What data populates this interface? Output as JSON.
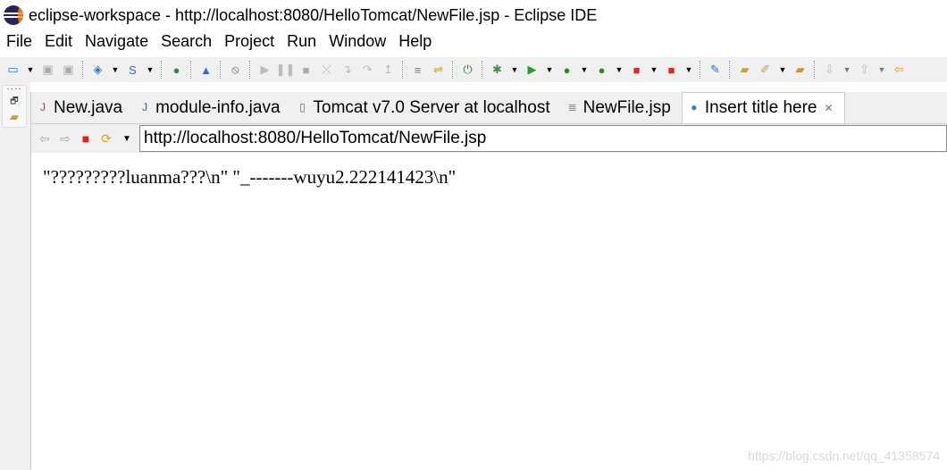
{
  "window": {
    "title": "eclipse-workspace - http://localhost:8080/HelloTomcat/NewFile.jsp - Eclipse IDE"
  },
  "menu": [
    "File",
    "Edit",
    "Navigate",
    "Search",
    "Project",
    "Run",
    "Window",
    "Help"
  ],
  "toolbar": [
    {
      "name": "new-wizard-icon",
      "glyph": "▭",
      "color": "#3a78c8"
    },
    {
      "name": "dropdown-icon",
      "glyph": "▼",
      "color": "#000",
      "dd": true
    },
    {
      "name": "save-icon",
      "glyph": "▣",
      "color": "#aaa"
    },
    {
      "name": "save-all-icon",
      "glyph": "▣",
      "color": "#aaa"
    },
    {
      "sep": true
    },
    {
      "name": "new-web-project-icon",
      "glyph": "◈",
      "color": "#3a78c8"
    },
    {
      "name": "dropdown-icon",
      "glyph": "▼",
      "color": "#000",
      "dd": true
    },
    {
      "name": "new-servlet-icon",
      "glyph": "S",
      "color": "#2a6ac8"
    },
    {
      "name": "dropdown-icon",
      "glyph": "▼",
      "color": "#000",
      "dd": true
    },
    {
      "sep": true
    },
    {
      "name": "open-web-browser-icon",
      "glyph": "●",
      "color": "#3c8a3c"
    },
    {
      "sep": true
    },
    {
      "name": "run-on-server-icon",
      "glyph": "▲",
      "color": "#3a6ac8"
    },
    {
      "sep": true
    },
    {
      "name": "skip-breakpoints-icon",
      "glyph": "⦸",
      "color": "#555"
    },
    {
      "sep": true
    },
    {
      "name": "resume-icon",
      "glyph": "▶",
      "color": "#bbb"
    },
    {
      "name": "suspend-icon",
      "glyph": "❚❚",
      "color": "#bbb"
    },
    {
      "name": "terminate-icon",
      "glyph": "■",
      "color": "#aaa"
    },
    {
      "name": "disconnect-icon",
      "glyph": "⤬",
      "color": "#aaa"
    },
    {
      "name": "step-into-icon",
      "glyph": "↴",
      "color": "#bbb"
    },
    {
      "name": "step-over-icon",
      "glyph": "↷",
      "color": "#bbb"
    },
    {
      "name": "step-return-icon",
      "glyph": "↥",
      "color": "#bbb"
    },
    {
      "sep": true
    },
    {
      "name": "drop-to-frame-icon",
      "glyph": "≡",
      "color": "#777"
    },
    {
      "name": "use-step-filters-icon",
      "glyph": "⇌",
      "color": "#c8a020"
    },
    {
      "sep": true
    },
    {
      "name": "start-server-icon",
      "glyph": "⏻",
      "color": "#2a8a2a"
    },
    {
      "sep": true
    },
    {
      "name": "debug-icon",
      "glyph": "✱",
      "color": "#4a8a4a"
    },
    {
      "name": "dropdown-icon",
      "glyph": "▼",
      "color": "#000",
      "dd": true
    },
    {
      "name": "run-icon",
      "glyph": "▶",
      "color": "#2a9a2a"
    },
    {
      "name": "dropdown-icon",
      "glyph": "▼",
      "color": "#000",
      "dd": true
    },
    {
      "name": "coverage-icon",
      "glyph": "●",
      "color": "#2a8a2a"
    },
    {
      "name": "dropdown-icon",
      "glyph": "▼",
      "color": "#000",
      "dd": true
    },
    {
      "name": "profile-icon",
      "glyph": "●",
      "color": "#2a8a2a"
    },
    {
      "name": "dropdown-icon",
      "glyph": "▼",
      "color": "#000",
      "dd": true
    },
    {
      "name": "stop-icon",
      "glyph": "■",
      "color": "#e02a2a"
    },
    {
      "name": "dropdown-icon",
      "glyph": "▼",
      "color": "#000",
      "dd": true
    },
    {
      "name": "external-tools-icon",
      "glyph": "■",
      "color": "#d02a2a"
    },
    {
      "name": "dropdown-icon",
      "glyph": "▼",
      "color": "#000",
      "dd": true
    },
    {
      "sep": true
    },
    {
      "name": "new-aspectj-icon",
      "glyph": "✎",
      "color": "#3a6ac8"
    },
    {
      "sep": true
    },
    {
      "name": "open-type-icon",
      "glyph": "▰",
      "color": "#c8a040"
    },
    {
      "name": "search-icon",
      "glyph": "✐",
      "color": "#c8a040"
    },
    {
      "name": "dropdown-icon",
      "glyph": "▼",
      "color": "#000",
      "dd": true
    },
    {
      "name": "open-task-icon",
      "glyph": "▰",
      "color": "#c89040"
    },
    {
      "sep": true
    },
    {
      "name": "next-annotation-icon",
      "glyph": "⇩",
      "color": "#bbb"
    },
    {
      "name": "dropdown-icon",
      "glyph": "▼",
      "color": "#777",
      "dd": true
    },
    {
      "name": "previous-annotation-icon",
      "glyph": "⇧",
      "color": "#bbb"
    },
    {
      "name": "dropdown-icon",
      "glyph": "▼",
      "color": "#777",
      "dd": true
    },
    {
      "name": "last-edit-location-icon",
      "glyph": "⇦",
      "color": "#d0a020"
    }
  ],
  "tabs": [
    {
      "label": "New.java",
      "icon": "java-file-error-icon",
      "glyph": "J",
      "color": "#c33"
    },
    {
      "label": "module-info.java",
      "icon": "java-file-icon",
      "glyph": "J",
      "color": "#2a5ab0"
    },
    {
      "label": "Tomcat v7.0 Server at localhost",
      "icon": "server-icon",
      "glyph": "▯",
      "color": "#666"
    },
    {
      "label": "NewFile.jsp",
      "icon": "jsp-file-icon",
      "glyph": "≣",
      "color": "#888"
    },
    {
      "label": "Insert title here",
      "icon": "globe-icon",
      "glyph": "●",
      "color": "#3a7ab0",
      "active": true
    }
  ],
  "browser": {
    "url": "http://localhost:8080/HelloTomcat/NewFile.jsp"
  },
  "page": {
    "content": "\"?????????luanma???\\n\" \"_-------wuyu2.222141423\\n\""
  },
  "watermark": "https://blog.csdn.net/qq_41358574"
}
